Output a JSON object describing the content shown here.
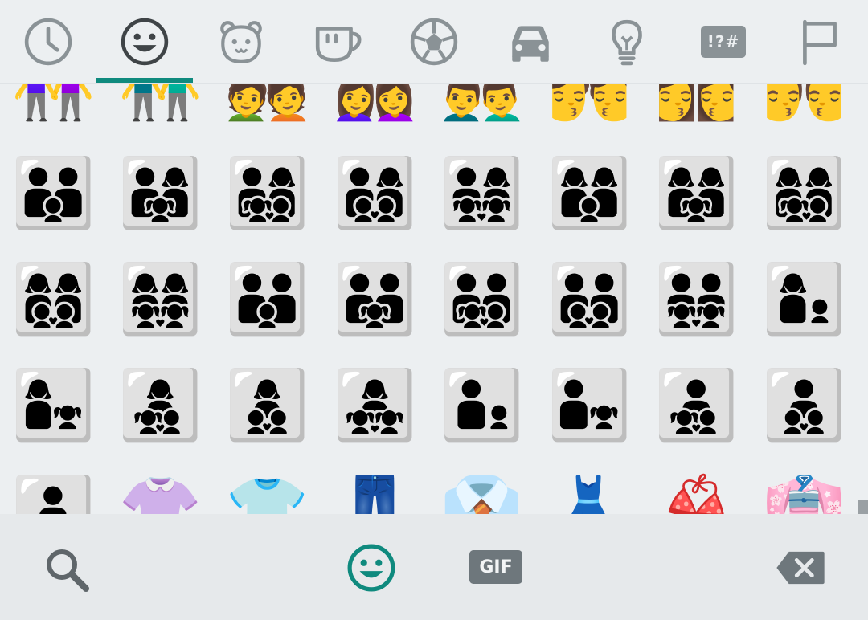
{
  "tabs": [
    {
      "id": "recent",
      "icon": "clock-icon"
    },
    {
      "id": "smileys",
      "icon": "smiley-icon",
      "active": true
    },
    {
      "id": "animals",
      "icon": "bear-icon"
    },
    {
      "id": "food",
      "icon": "cup-icon"
    },
    {
      "id": "activity",
      "icon": "soccer-ball-icon"
    },
    {
      "id": "travel",
      "icon": "car-icon"
    },
    {
      "id": "objects",
      "icon": "lightbulb-icon"
    },
    {
      "id": "symbols",
      "icon": "symbols-icon",
      "label": "!?#"
    },
    {
      "id": "flags",
      "icon": "flag-icon"
    }
  ],
  "colors": {
    "accent": "#0f8a7e",
    "icon_gray": "#8a9296",
    "background": "#eceff1"
  },
  "emoji_rows": [
    [
      "👭",
      "👬",
      "💑",
      "👩‍❤️‍👩",
      "👨‍❤️‍👨",
      "💏",
      "👩‍❤️‍💋‍👩",
      "👨‍❤️‍💋‍👨"
    ],
    [
      "👪",
      "👨‍👩‍👧",
      "👨‍👩‍👧‍👦",
      "👨‍👩‍👦‍👦",
      "👨‍👩‍👧‍👧",
      "👩‍👩‍👦",
      "👩‍👩‍👧",
      "👩‍👩‍👧‍👦"
    ],
    [
      "👩‍👩‍👦‍👦",
      "👩‍👩‍👧‍👧",
      "👨‍👨‍👦",
      "👨‍👨‍👧",
      "👨‍👨‍👧‍👦",
      "👨‍👨‍👦‍👦",
      "👨‍👨‍👧‍👧",
      "👩‍👦"
    ],
    [
      "👩‍👧",
      "👩‍👧‍👦",
      "👩‍👦‍👦",
      "👩‍👧‍👧",
      "👨‍👦",
      "👨‍👧",
      "👨‍👧‍👦",
      "👨‍👦‍👦"
    ],
    [
      "👨‍👧‍👧",
      "👚",
      "👕",
      "👖",
      "👔",
      "👗",
      "👙",
      "👘"
    ]
  ],
  "bottom": {
    "search_icon": "search-icon",
    "emoji_icon": "smiley-icon",
    "gif_label": "GIF",
    "backspace_icon": "backspace-icon"
  }
}
